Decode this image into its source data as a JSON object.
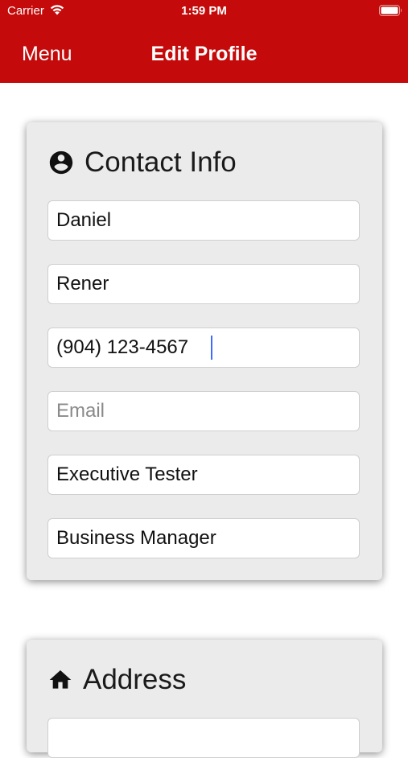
{
  "status_bar": {
    "carrier": "Carrier",
    "time": "1:59 PM"
  },
  "nav": {
    "menu_label": "Menu",
    "title": "Edit Profile"
  },
  "colors": {
    "header": "#c40a0a",
    "card_bg": "#ebebeb",
    "caret": "#3b6cff"
  },
  "contact_section": {
    "title": "Contact Info",
    "icon": "account-circle-icon",
    "fields": {
      "first_name": {
        "value": "Daniel",
        "placeholder": ""
      },
      "last_name": {
        "value": "Rener",
        "placeholder": ""
      },
      "phone": {
        "value": "(904) 123-4567",
        "placeholder": ""
      },
      "email": {
        "value": "",
        "placeholder": "Email"
      },
      "job_title": {
        "value": "Executive Tester",
        "placeholder": ""
      },
      "department": {
        "value": "Business Manager",
        "placeholder": ""
      }
    }
  },
  "address_section": {
    "title": "Address",
    "icon": "home-icon"
  }
}
